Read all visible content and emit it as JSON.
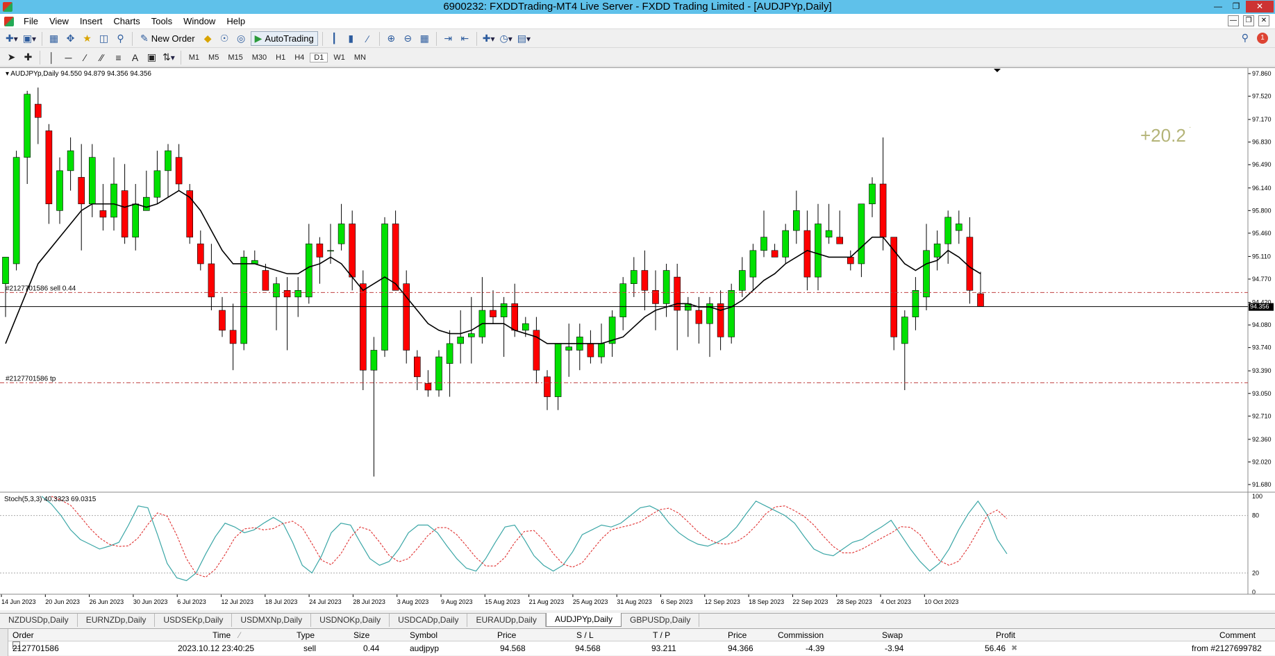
{
  "window": {
    "title": "6900232: FXDDTrading-MT4 Live Server - FXDD Trading Limited - [AUDJPYp,Daily]"
  },
  "menu": [
    "File",
    "View",
    "Insert",
    "Charts",
    "Tools",
    "Window",
    "Help"
  ],
  "toolbar": {
    "new_order_label": "New Order",
    "autotrading_label": "AutoTrading",
    "timeframes": [
      "M1",
      "M5",
      "M15",
      "M30",
      "H1",
      "H4",
      "D1",
      "W1",
      "MN"
    ],
    "active_timeframe": "D1",
    "alert_count": "1"
  },
  "chart": {
    "header": "AUDJPYp,Daily  94.550 94.879 94.356 94.356",
    "current_price": "94.356",
    "profit_overlay": "+20.2",
    "sell_line_label": "#2127701586 sell 0.44",
    "tp_line_label": "#2127701586 tp",
    "sell_price": 94.568,
    "tp_price": 93.211,
    "price_axis": [
      "97.860",
      "97.520",
      "97.170",
      "96.830",
      "96.490",
      "96.140",
      "95.800",
      "95.460",
      "95.110",
      "94.770",
      "94.420",
      "94.080",
      "93.740",
      "93.390",
      "93.050",
      "92.710",
      "92.360",
      "92.020",
      "91.680"
    ],
    "date_axis": [
      "14 Jun 2023",
      "20 Jun 2023",
      "26 Jun 2023",
      "30 Jun 2023",
      "6 Jul 2023",
      "12 Jul 2023",
      "18 Jul 2023",
      "24 Jul 2023",
      "28 Jul 2023",
      "3 Aug 2023",
      "9 Aug 2023",
      "15 Aug 2023",
      "21 Aug 2023",
      "25 Aug 2023",
      "31 Aug 2023",
      "6 Sep 2023",
      "12 Sep 2023",
      "18 Sep 2023",
      "22 Sep 2023",
      "28 Sep 2023",
      "4 Oct 2023",
      "10 Oct 2023"
    ],
    "colors": {
      "bull": "#00e000",
      "bear": "#ff0000",
      "ma": "#000000",
      "stoch_main": "#3aa6a6",
      "stoch_signal": "#e03030",
      "profit": "#b4b478"
    }
  },
  "stochastic": {
    "label": "Stoch(5,3,3) 40.3323 69.0315",
    "levels": [
      "100",
      "80",
      "20",
      "0"
    ]
  },
  "tabs": [
    "NZDUSDp,Daily",
    "EURNZDp,Daily",
    "USDSEKp,Daily",
    "USDMXNp,Daily",
    "USDNOKp,Daily",
    "USDCADp,Daily",
    "EURAUDp,Daily",
    "AUDJPYp,Daily",
    "GBPUSDp,Daily"
  ],
  "active_tab": "AUDJPYp,Daily",
  "terminal": {
    "headers": {
      "order": "Order",
      "time": "Time",
      "type": "Type",
      "size": "Size",
      "symbol": "Symbol",
      "price": "Price",
      "sl": "S / L",
      "tp": "T / P",
      "price2": "Price",
      "commission": "Commission",
      "swap": "Swap",
      "profit": "Profit",
      "comment": "Comment"
    },
    "row": {
      "order": "2127701586",
      "time": "2023.10.12 23:40:25",
      "type": "sell",
      "size": "0.44",
      "symbol": "audjpyp",
      "price": "94.568",
      "sl": "94.568",
      "tp": "93.211",
      "price2": "94.366",
      "commission": "-4.39",
      "swap": "-3.94",
      "profit": "56.46",
      "comment": "from #2127699782"
    }
  },
  "chart_data": {
    "type": "candlestick",
    "symbol": "AUDJPYp",
    "timeframe": "Daily",
    "ylim": [
      91.68,
      97.86
    ],
    "candles": [
      {
        "o": 94.7,
        "h": 95.1,
        "l": 94.2,
        "c": 95.1
      },
      {
        "o": 95.0,
        "h": 96.7,
        "l": 94.9,
        "c": 96.6
      },
      {
        "o": 96.6,
        "h": 97.6,
        "l": 96.2,
        "c": 97.55
      },
      {
        "o": 97.4,
        "h": 97.65,
        "l": 96.8,
        "c": 97.2
      },
      {
        "o": 97.0,
        "h": 97.1,
        "l": 95.6,
        "c": 95.9
      },
      {
        "o": 95.8,
        "h": 96.6,
        "l": 95.6,
        "c": 96.4
      },
      {
        "o": 96.4,
        "h": 96.9,
        "l": 96.1,
        "c": 96.7
      },
      {
        "o": 96.3,
        "h": 96.8,
        "l": 95.2,
        "c": 95.9
      },
      {
        "o": 95.9,
        "h": 96.8,
        "l": 95.7,
        "c": 96.6
      },
      {
        "o": 95.8,
        "h": 96.2,
        "l": 95.5,
        "c": 95.7
      },
      {
        "o": 95.7,
        "h": 96.6,
        "l": 95.5,
        "c": 96.2
      },
      {
        "o": 96.1,
        "h": 96.5,
        "l": 95.3,
        "c": 95.4
      },
      {
        "o": 95.4,
        "h": 96.2,
        "l": 95.2,
        "c": 95.9
      },
      {
        "o": 95.8,
        "h": 96.4,
        "l": 95.8,
        "c": 96.0
      },
      {
        "o": 96.0,
        "h": 96.7,
        "l": 95.9,
        "c": 96.4
      },
      {
        "o": 96.4,
        "h": 96.8,
        "l": 96.0,
        "c": 96.7
      },
      {
        "o": 96.6,
        "h": 96.8,
        "l": 96.1,
        "c": 96.2
      },
      {
        "o": 96.1,
        "h": 96.2,
        "l": 95.3,
        "c": 95.4
      },
      {
        "o": 95.3,
        "h": 95.5,
        "l": 94.9,
        "c": 95.0
      },
      {
        "o": 95.0,
        "h": 95.3,
        "l": 94.3,
        "c": 94.5
      },
      {
        "o": 94.3,
        "h": 94.5,
        "l": 93.9,
        "c": 94.0
      },
      {
        "o": 94.0,
        "h": 94.4,
        "l": 93.4,
        "c": 93.8
      },
      {
        "o": 93.8,
        "h": 95.2,
        "l": 93.7,
        "c": 95.1
      },
      {
        "o": 95.0,
        "h": 95.2,
        "l": 95.0,
        "c": 95.05
      },
      {
        "o": 94.9,
        "h": 95.0,
        "l": 94.6,
        "c": 94.6
      },
      {
        "o": 94.5,
        "h": 94.8,
        "l": 94.0,
        "c": 94.7
      },
      {
        "o": 94.6,
        "h": 94.8,
        "l": 93.7,
        "c": 94.5
      },
      {
        "o": 94.5,
        "h": 94.8,
        "l": 94.2,
        "c": 94.6
      },
      {
        "o": 94.5,
        "h": 95.6,
        "l": 94.4,
        "c": 95.3
      },
      {
        "o": 95.3,
        "h": 95.4,
        "l": 94.7,
        "c": 95.1
      },
      {
        "o": 95.2,
        "h": 95.6,
        "l": 95.0,
        "c": 95.2
      },
      {
        "o": 95.3,
        "h": 95.9,
        "l": 95.2,
        "c": 95.6
      },
      {
        "o": 95.6,
        "h": 95.8,
        "l": 94.6,
        "c": 94.8
      },
      {
        "o": 94.7,
        "h": 94.9,
        "l": 93.1,
        "c": 93.4
      },
      {
        "o": 93.4,
        "h": 93.9,
        "l": 91.8,
        "c": 93.7
      },
      {
        "o": 93.7,
        "h": 95.7,
        "l": 93.6,
        "c": 95.6
      },
      {
        "o": 95.6,
        "h": 95.8,
        "l": 94.6,
        "c": 94.6
      },
      {
        "o": 94.7,
        "h": 94.9,
        "l": 93.5,
        "c": 93.7
      },
      {
        "o": 93.6,
        "h": 93.7,
        "l": 93.1,
        "c": 93.3
      },
      {
        "o": 93.2,
        "h": 93.4,
        "l": 93.0,
        "c": 93.1
      },
      {
        "o": 93.1,
        "h": 93.7,
        "l": 93.0,
        "c": 93.6
      },
      {
        "o": 93.5,
        "h": 94.0,
        "l": 93.0,
        "c": 93.8
      },
      {
        "o": 93.8,
        "h": 94.3,
        "l": 93.5,
        "c": 93.9
      },
      {
        "o": 93.9,
        "h": 94.5,
        "l": 93.5,
        "c": 93.95
      },
      {
        "o": 93.9,
        "h": 94.8,
        "l": 93.8,
        "c": 94.3
      },
      {
        "o": 94.3,
        "h": 94.6,
        "l": 94.1,
        "c": 94.2
      },
      {
        "o": 94.2,
        "h": 94.5,
        "l": 93.6,
        "c": 94.4
      },
      {
        "o": 94.4,
        "h": 94.7,
        "l": 93.9,
        "c": 94.0
      },
      {
        "o": 94.0,
        "h": 94.2,
        "l": 93.9,
        "c": 94.1
      },
      {
        "o": 94.0,
        "h": 94.2,
        "l": 93.2,
        "c": 93.4
      },
      {
        "o": 93.3,
        "h": 93.4,
        "l": 92.8,
        "c": 93.0
      },
      {
        "o": 93.0,
        "h": 93.8,
        "l": 92.8,
        "c": 93.8
      },
      {
        "o": 93.7,
        "h": 94.1,
        "l": 93.3,
        "c": 93.75
      },
      {
        "o": 93.7,
        "h": 94.1,
        "l": 93.4,
        "c": 93.9
      },
      {
        "o": 93.8,
        "h": 94.0,
        "l": 93.5,
        "c": 93.6
      },
      {
        "o": 93.6,
        "h": 94.1,
        "l": 93.5,
        "c": 93.8
      },
      {
        "o": 93.8,
        "h": 94.3,
        "l": 93.6,
        "c": 94.2
      },
      {
        "o": 94.2,
        "h": 94.8,
        "l": 94.0,
        "c": 94.7
      },
      {
        "o": 94.7,
        "h": 95.1,
        "l": 94.5,
        "c": 94.9
      },
      {
        "o": 94.9,
        "h": 95.2,
        "l": 94.3,
        "c": 94.6
      },
      {
        "o": 94.6,
        "h": 94.9,
        "l": 94.0,
        "c": 94.4
      },
      {
        "o": 94.4,
        "h": 95.0,
        "l": 94.2,
        "c": 94.9
      },
      {
        "o": 94.8,
        "h": 95.0,
        "l": 93.7,
        "c": 94.3
      },
      {
        "o": 94.3,
        "h": 94.5,
        "l": 93.9,
        "c": 94.4
      },
      {
        "o": 94.3,
        "h": 94.5,
        "l": 93.8,
        "c": 94.1
      },
      {
        "o": 94.1,
        "h": 94.5,
        "l": 93.6,
        "c": 94.4
      },
      {
        "o": 94.4,
        "h": 94.6,
        "l": 93.7,
        "c": 93.9
      },
      {
        "o": 93.9,
        "h": 94.7,
        "l": 93.8,
        "c": 94.6
      },
      {
        "o": 94.6,
        "h": 95.1,
        "l": 94.5,
        "c": 94.9
      },
      {
        "o": 94.8,
        "h": 95.3,
        "l": 94.6,
        "c": 95.2
      },
      {
        "o": 95.2,
        "h": 95.8,
        "l": 95.1,
        "c": 95.4
      },
      {
        "o": 95.2,
        "h": 95.3,
        "l": 95.1,
        "c": 95.1
      },
      {
        "o": 95.1,
        "h": 95.6,
        "l": 95.0,
        "c": 95.5
      },
      {
        "o": 95.5,
        "h": 96.1,
        "l": 95.3,
        "c": 95.8
      },
      {
        "o": 95.5,
        "h": 95.8,
        "l": 94.6,
        "c": 94.8
      },
      {
        "o": 94.8,
        "h": 95.9,
        "l": 94.6,
        "c": 95.6
      },
      {
        "o": 95.4,
        "h": 95.9,
        "l": 95.3,
        "c": 95.5
      },
      {
        "o": 95.4,
        "h": 95.8,
        "l": 95.3,
        "c": 95.3
      },
      {
        "o": 95.1,
        "h": 95.2,
        "l": 94.9,
        "c": 95.0
      },
      {
        "o": 95.0,
        "h": 95.9,
        "l": 94.8,
        "c": 95.9
      },
      {
        "o": 95.9,
        "h": 96.3,
        "l": 95.7,
        "c": 96.2
      },
      {
        "o": 96.2,
        "h": 96.9,
        "l": 95.2,
        "c": 95.4
      },
      {
        "o": 95.4,
        "h": 95.4,
        "l": 93.7,
        "c": 93.9
      },
      {
        "o": 93.8,
        "h": 94.3,
        "l": 93.1,
        "c": 94.2
      },
      {
        "o": 94.2,
        "h": 94.8,
        "l": 94.0,
        "c": 94.6
      },
      {
        "o": 94.5,
        "h": 95.6,
        "l": 94.3,
        "c": 95.2
      },
      {
        "o": 95.1,
        "h": 95.5,
        "l": 94.9,
        "c": 95.3
      },
      {
        "o": 95.3,
        "h": 95.8,
        "l": 95.0,
        "c": 95.7
      },
      {
        "o": 95.5,
        "h": 95.8,
        "l": 95.3,
        "c": 95.6
      },
      {
        "o": 95.4,
        "h": 95.7,
        "l": 94.4,
        "c": 94.6
      },
      {
        "o": 94.55,
        "h": 94.88,
        "l": 94.36,
        "c": 94.36
      }
    ],
    "ma": [
      93.8,
      94.2,
      94.6,
      95.0,
      95.2,
      95.4,
      95.6,
      95.8,
      95.9,
      95.9,
      95.9,
      95.85,
      95.9,
      95.85,
      95.9,
      96.0,
      96.1,
      96.0,
      95.8,
      95.5,
      95.2,
      95.0,
      95.0,
      95.0,
      94.95,
      94.9,
      94.85,
      94.85,
      94.95,
      95.0,
      95.1,
      95.0,
      94.8,
      94.6,
      94.7,
      94.8,
      94.7,
      94.5,
      94.3,
      94.1,
      94.0,
      93.95,
      93.95,
      94.0,
      94.1,
      94.1,
      94.1,
      94.0,
      93.95,
      93.9,
      93.8,
      93.8,
      93.8,
      93.8,
      93.8,
      93.8,
      93.85,
      93.9,
      94.05,
      94.2,
      94.3,
      94.35,
      94.4,
      94.4,
      94.35,
      94.35,
      94.3,
      94.35,
      94.45,
      94.6,
      94.75,
      94.85,
      95.0,
      95.1,
      95.2,
      95.15,
      95.1,
      95.1,
      95.1,
      95.25,
      95.4,
      95.4,
      95.2,
      95.0,
      94.9,
      95.0,
      95.05,
      95.2,
      95.1,
      94.95,
      94.85
    ],
    "stoch_main": [
      100,
      92,
      80,
      65,
      55,
      50,
      45,
      48,
      52,
      70,
      90,
      88,
      60,
      30,
      15,
      12,
      20,
      40,
      58,
      72,
      68,
      62,
      65,
      72,
      78,
      72,
      52,
      28,
      20,
      38,
      62,
      72,
      70,
      52,
      35,
      28,
      32,
      45,
      62,
      70,
      70,
      62,
      48,
      35,
      25,
      22,
      35,
      52,
      68,
      70,
      55,
      38,
      28,
      22,
      28,
      42,
      60,
      65,
      70,
      68,
      72,
      80,
      88,
      90,
      85,
      72,
      62,
      55,
      50,
      48,
      52,
      58,
      68,
      82,
      95,
      90,
      85,
      80,
      72,
      58,
      45,
      40,
      38,
      45,
      52,
      55,
      62,
      68,
      75,
      60,
      45,
      32,
      22,
      30,
      45,
      65,
      82,
      95,
      80,
      55,
      40
    ]
  }
}
